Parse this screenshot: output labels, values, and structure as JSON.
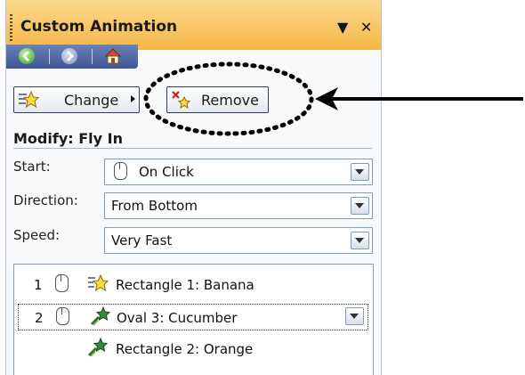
{
  "panel": {
    "title": "Custom Animation",
    "dropdown_glyph": "▼",
    "close_glyph": "✕"
  },
  "nav": {
    "back_icon": "back-arrow-icon",
    "forward_icon": "forward-arrow-icon",
    "home_icon": "home-icon"
  },
  "toolbar": {
    "change_label": "Change",
    "remove_label": "Remove"
  },
  "modify": {
    "heading": "Modify: Fly In",
    "fields": [
      {
        "label": "Start:",
        "value": "On Click"
      },
      {
        "label": "Direction:",
        "value": "From Bottom"
      },
      {
        "label": "Speed:",
        "value": "Very Fast"
      }
    ]
  },
  "animation_list": [
    {
      "number": "1",
      "name": "Rectangle 1: Banana",
      "trigger_icon": "mouse-click-icon",
      "effect_icon": "star-effect-icon"
    },
    {
      "number": "2",
      "name": "Oval 3: Cucumber",
      "trigger_icon": "mouse-click-icon",
      "effect_icon": "fly-in-effect-icon",
      "selected": true
    },
    {
      "number": "",
      "name": "Rectangle 2: Orange",
      "trigger_icon": "",
      "effect_icon": "fly-in-effect-icon"
    }
  ],
  "colors": {
    "title_bar": "#f4b648",
    "nav_bar": "#3f5696",
    "annotation": "#000000"
  }
}
